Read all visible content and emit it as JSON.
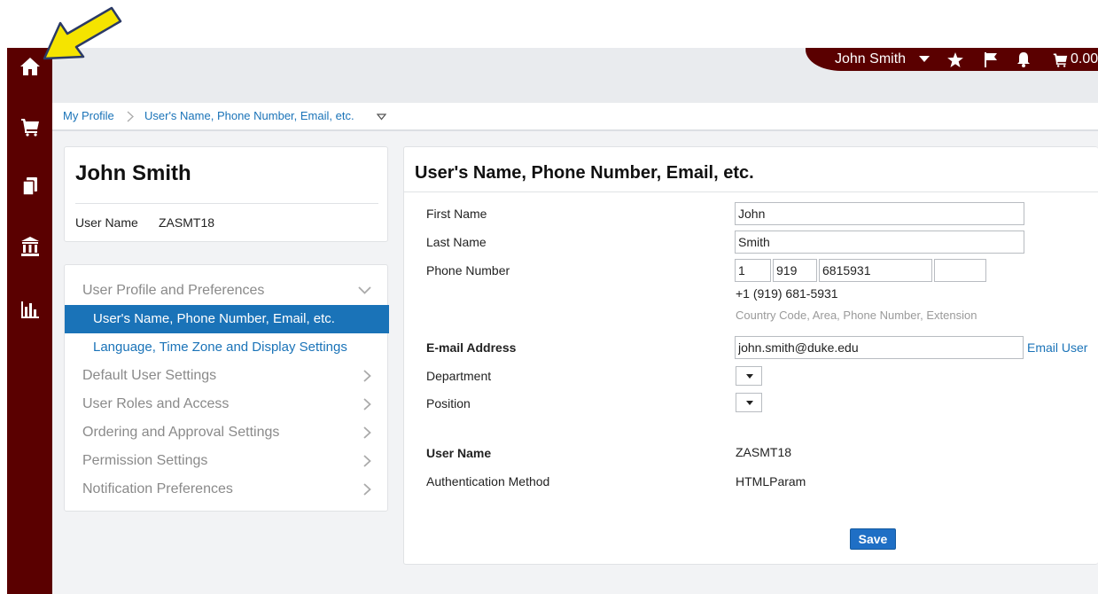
{
  "header": {
    "user_name": "John Smith",
    "cart_total": "0.00"
  },
  "breadcrumb": {
    "items": [
      "My Profile",
      "User's Name, Phone Number, Email, etc."
    ]
  },
  "profile": {
    "name": "John Smith",
    "user_name_label": "User Name",
    "user_name_value": "ZASMT18"
  },
  "nav": {
    "sections": [
      {
        "label": "User Profile and Preferences",
        "expanded": true,
        "children": [
          {
            "label": "User's Name, Phone Number, Email, etc.",
            "active": true
          },
          {
            "label": "Language, Time Zone and Display Settings",
            "active": false
          }
        ]
      },
      {
        "label": "Default User Settings"
      },
      {
        "label": "User Roles and Access"
      },
      {
        "label": "Ordering and Approval Settings"
      },
      {
        "label": "Permission Settings"
      },
      {
        "label": "Notification Preferences"
      }
    ]
  },
  "form": {
    "title": "User's Name, Phone Number, Email, etc.",
    "first_name_label": "First Name",
    "first_name_value": "John",
    "last_name_label": "Last Name",
    "last_name_value": "Smith",
    "phone_label": "Phone Number",
    "phone_country": "1",
    "phone_area": "919",
    "phone_number": "6815931",
    "phone_extension": "",
    "phone_formatted": "+1 (919) 681-5931",
    "phone_hint": "Country Code, Area, Phone Number, Extension",
    "email_label": "E-mail Address",
    "email_value": "john.smith@duke.edu",
    "email_link": "Email User",
    "department_label": "Department",
    "position_label": "Position",
    "username_label": "User Name",
    "username_value": "ZASMT18",
    "auth_label": "Authentication Method",
    "auth_value": "HTMLParam",
    "save_label": "Save"
  },
  "colors": {
    "rail": "#5a0000",
    "accent": "#1a73b8",
    "pointer": "#f5e400"
  },
  "icons": {
    "rail": [
      "home-icon",
      "cart-icon",
      "documents-icon",
      "bank-icon",
      "bar-chart-icon"
    ],
    "header": [
      "caret-down-icon",
      "star-icon",
      "flag-icon",
      "bell-icon",
      "cart-icon"
    ]
  }
}
